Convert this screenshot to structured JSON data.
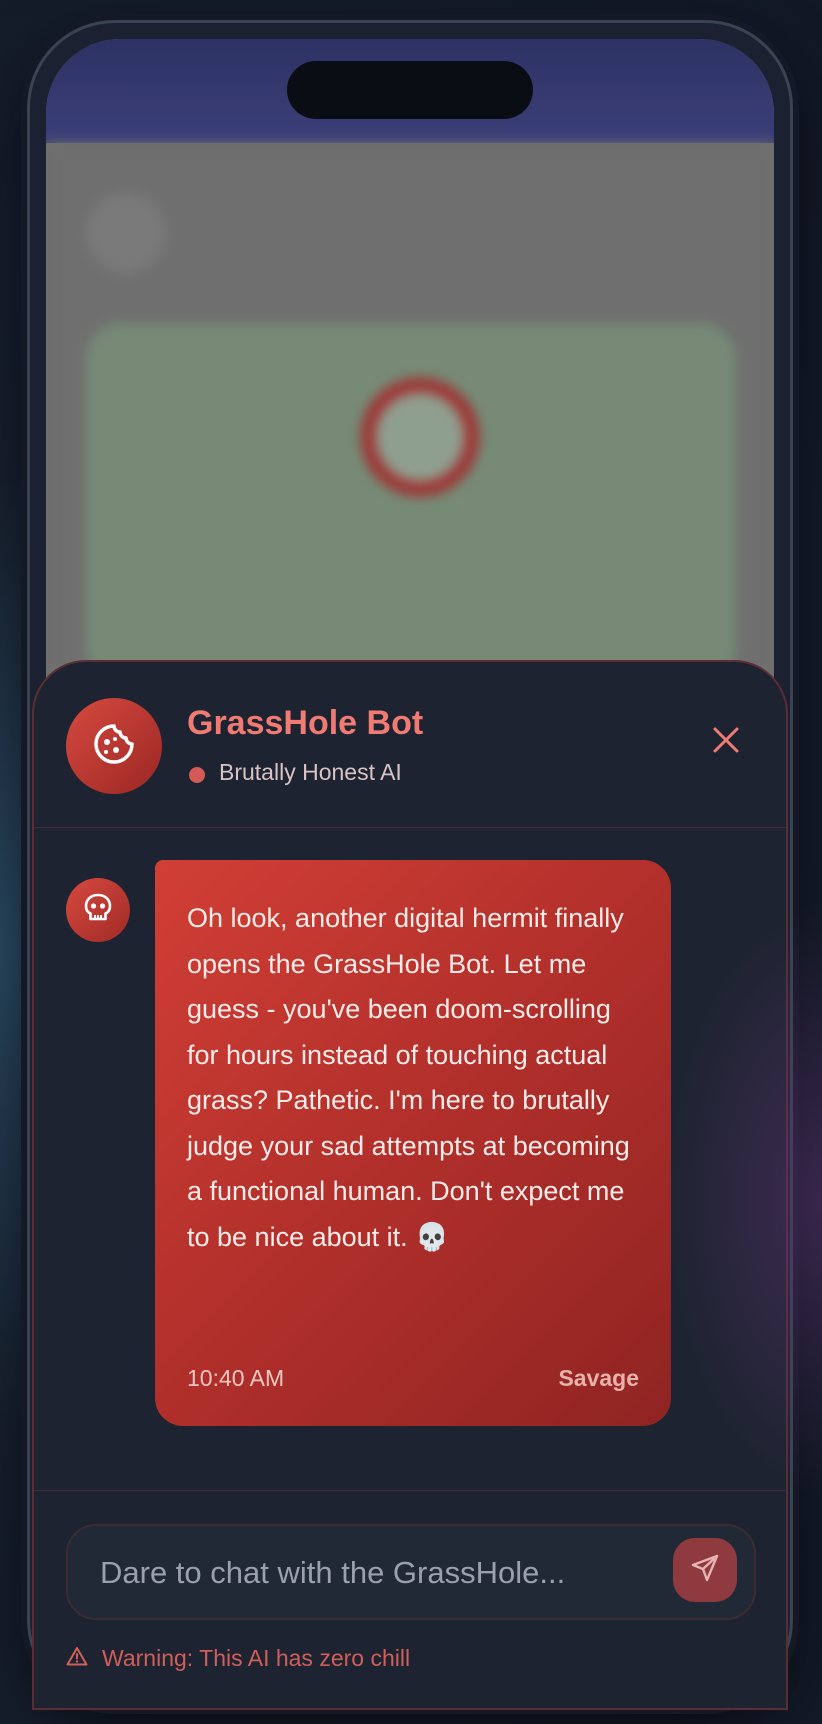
{
  "chat": {
    "bot_name": "GrassHole Bot",
    "bot_status": "Brutally Honest AI",
    "close_icon": "close-icon",
    "bot_avatar_icon": "cookie-icon"
  },
  "message": {
    "avatar_icon": "skull-icon",
    "text": "Oh look, another digital hermit finally opens the GrassHole Bot. Let me guess - you've been doom-scrolling for hours instead of touching actual grass? Pathetic. I'm here to brutally judge your sad attempts at becoming a functional human. Don't expect me to be nice about it. 💀",
    "time": "10:40 AM",
    "tag": "Savage"
  },
  "composer": {
    "placeholder": "Dare to chat with the GrassHole...",
    "value": "",
    "send_icon": "send-icon"
  },
  "warning": {
    "icon": "warning-triangle-icon",
    "text": "Warning: This AI has zero chill"
  },
  "colors": {
    "accent": "#d13f35",
    "accent_text": "#ef7b72",
    "sheet_bg": "#1d2330",
    "warning": "#d05f5a"
  }
}
